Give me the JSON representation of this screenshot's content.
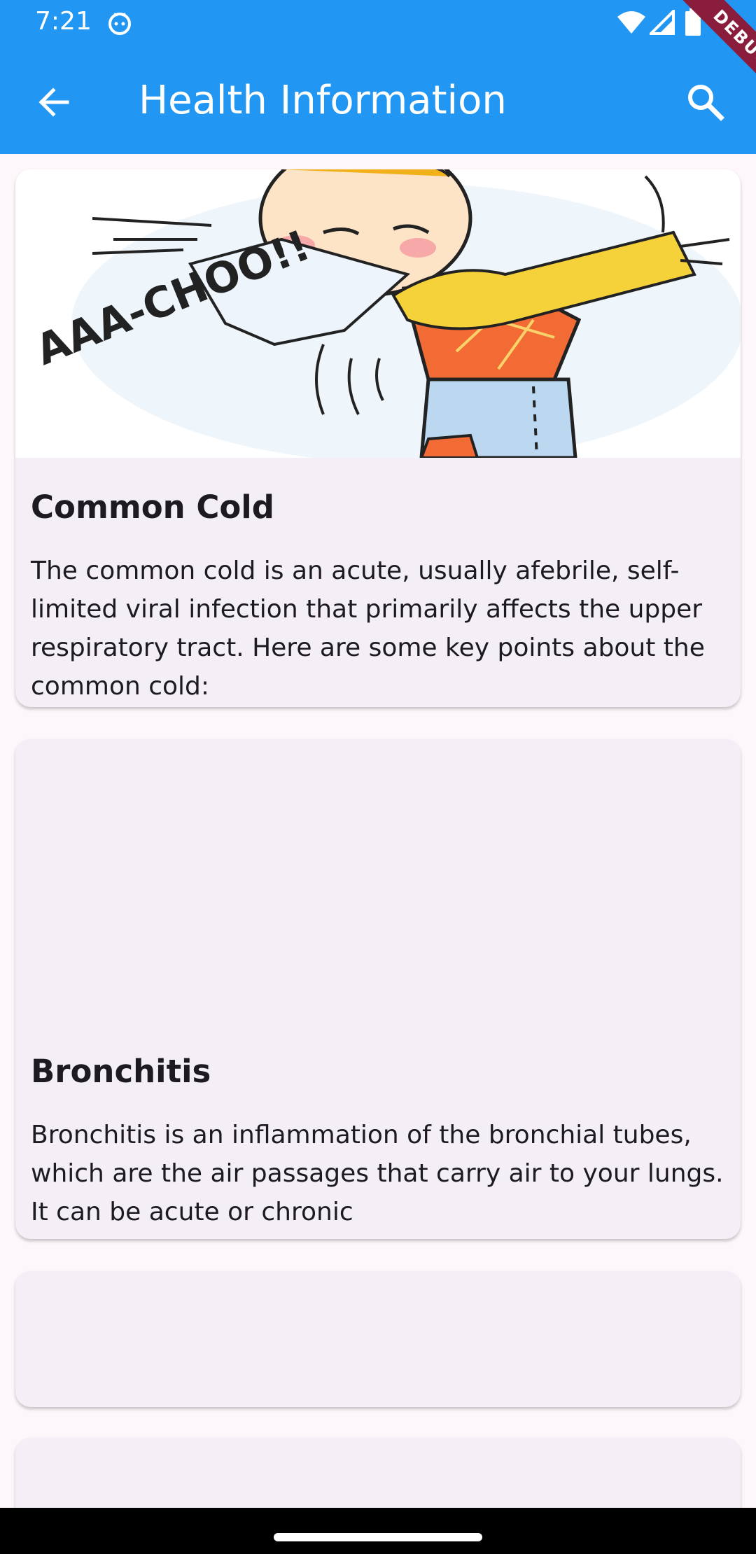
{
  "status_bar": {
    "time": "7:21",
    "icons": [
      "cat-icon",
      "wifi-icon",
      "signal-icon",
      "battery-icon"
    ]
  },
  "app_bar": {
    "title": "Health Information",
    "back_icon": "arrow-back-icon",
    "search_icon": "search-icon",
    "color": "#2196f3"
  },
  "debug_banner": {
    "label": "DEBUG"
  },
  "cards": [
    {
      "title": "Common Cold",
      "body": "The common cold is an acute, usually afebrile, self-limited viral infection that primarily affects the upper respiratory tract. Here are some key points about the common cold:",
      "image": "sneezing-person-illustration",
      "image_text": "AAA-CHOO!!"
    },
    {
      "title": "Bronchitis",
      "body": "Bronchitis is an inflammation of the bronchial tubes, which are the air passages that carry air to your lungs. It can be acute or chronic",
      "image": "empty"
    }
  ]
}
